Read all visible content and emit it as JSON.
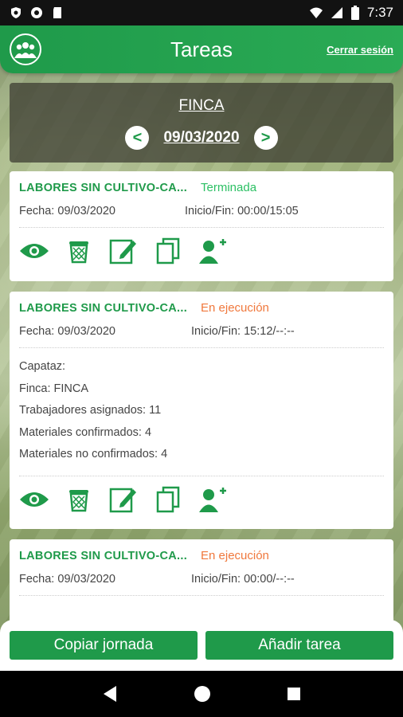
{
  "status_bar": {
    "time": "7:37",
    "icons": [
      "shield-icon",
      "circle-icon",
      "sd-card-icon",
      "wifi-icon",
      "signal-icon",
      "battery-icon"
    ]
  },
  "app_bar": {
    "title": "Tareas",
    "logout_label": "Cerrar sesión",
    "logo_icon": "group-logo-icon"
  },
  "header": {
    "farm": "FINCA",
    "date": "09/03/2020",
    "prev_label": "<",
    "next_label": ">"
  },
  "tasks": [
    {
      "title": "LABORES SIN CULTIVO-CA...",
      "status": "Terminada",
      "fecha_label": "Fecha:",
      "fecha": "09/03/2020",
      "inicio_label": "Inicio/Fin:",
      "inicio_fin": "00:00/15:05"
    },
    {
      "title": "LABORES SIN CULTIVO-CA...",
      "status": "En ejecución",
      "fecha_label": "Fecha:",
      "fecha": "09/03/2020",
      "inicio_label": "Inicio/Fin:",
      "inicio_fin": "15:12/--:--",
      "details": {
        "capataz_label": "Capataz:",
        "finca_label": "Finca:",
        "finca": "FINCA",
        "trabajadores_label": "Trabajadores asignados:",
        "trabajadores": "11",
        "mat_conf_label": "Materiales confirmados:",
        "mat_conf": "4",
        "mat_noconf_label": "Materiales no confirmados:",
        "mat_noconf": "4"
      }
    },
    {
      "title": "LABORES SIN CULTIVO-CA...",
      "status": "En ejecución",
      "fecha_label": "Fecha:",
      "fecha": "09/03/2020",
      "inicio_label": "Inicio/Fin:",
      "inicio_fin": "00:00/--:--"
    }
  ],
  "actions": [
    "view-icon",
    "delete-icon",
    "edit-icon",
    "copy-icon",
    "add-worker-icon"
  ],
  "bottom": {
    "copy_label": "Copiar jornada",
    "add_label": "Añadir tarea"
  },
  "colors": {
    "primary": "#1f9a4a",
    "finished": "#2cc064",
    "running": "#f0783c"
  }
}
